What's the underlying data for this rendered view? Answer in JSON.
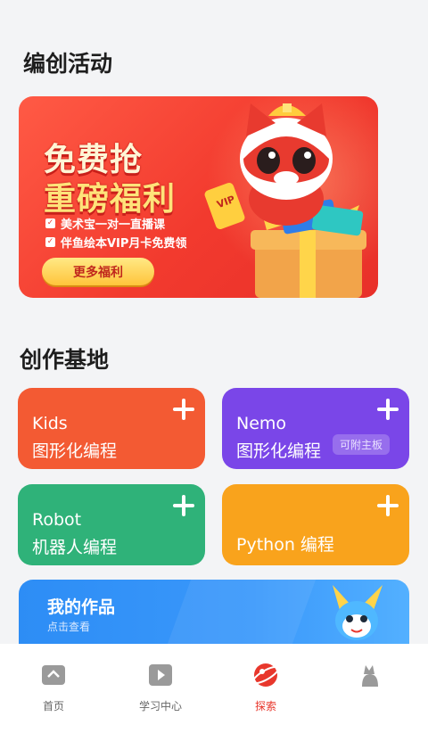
{
  "sections": {
    "activities_title": "编创活动",
    "base_title": "创作基地"
  },
  "banner": {
    "headline_1": "免费抢",
    "headline_2": "重磅福利",
    "bullet_1": "美术宝一对一直播课",
    "bullet_2": "伴鱼绘本VIP月卡免费领",
    "button": "更多福利",
    "vip_tag": "VIP"
  },
  "cards": {
    "kids": {
      "line1": "Kids",
      "line2": "图形化编程",
      "color": "#f35a33"
    },
    "nemo": {
      "line1": "Nemo",
      "line2": "图形化编程",
      "tag": "可附主板",
      "color": "#7a46e8"
    },
    "robot": {
      "line1": "Robot",
      "line2": "机器人编程",
      "color": "#2fb279"
    },
    "python": {
      "line1": "Python 编程",
      "color": "#f9a31c"
    }
  },
  "works": {
    "title": "我的作品",
    "subtitle": "点击查看"
  },
  "tabbar": {
    "items": [
      {
        "label": "首页",
        "icon": "home-icon"
      },
      {
        "label": "学习中心",
        "icon": "play-icon"
      },
      {
        "label": "探索",
        "icon": "explore-planet-icon",
        "active": true
      },
      {
        "label": "",
        "icon": "profile-icon"
      }
    ],
    "active_color": "#e8372c"
  }
}
